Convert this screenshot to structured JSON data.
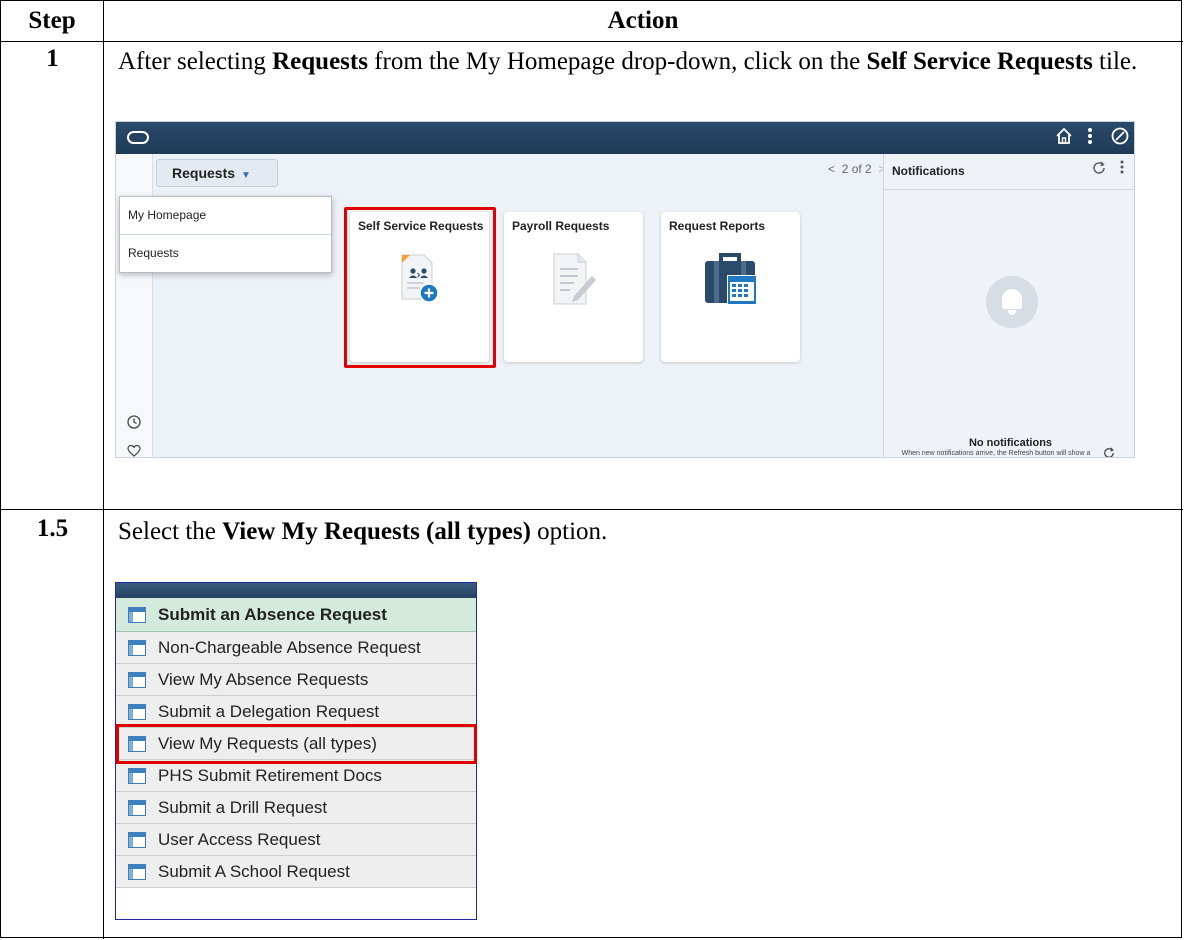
{
  "table": {
    "header_step": "Step",
    "header_action": "Action"
  },
  "steps": [
    {
      "number": "1",
      "text_parts": [
        "After selecting ",
        "Requests",
        " from the My Homepage drop-down, click on the ",
        "Self Service Requests",
        " tile."
      ]
    },
    {
      "number": "1.5",
      "text_parts": [
        "Select the ",
        "View My Requests (all types)",
        " option."
      ]
    }
  ],
  "screenshot1": {
    "requests_button": "Requests",
    "dropdown_items": [
      "My Homepage",
      "Requests"
    ],
    "pager": "2 of 2",
    "tiles": [
      "Self Service Requests",
      "Payroll Requests",
      "Request Reports"
    ],
    "notifications_title": "Notifications",
    "no_notifications": "No notifications",
    "no_notifications_sub": "When new notifications arrive, the Refresh button will show a badge",
    "icons": [
      "home-icon",
      "more-icon",
      "compass-icon",
      "clock-icon",
      "heart-icon",
      "refresh-icon",
      "bell-icon"
    ],
    "highlight_color": "#e00000"
  },
  "screenshot2": {
    "menu_items": [
      "Submit an Absence Request",
      "Non-Chargeable Absence Request",
      "View My Absence Requests",
      "Submit a Delegation Request",
      "View My Requests (all types)",
      "PHS Submit Retirement Docs",
      "Submit a Drill Request",
      "User Access Request",
      "Submit A School Request"
    ],
    "highlighted_item": "View My Requests (all types)",
    "highlight_color": "#e00000"
  }
}
